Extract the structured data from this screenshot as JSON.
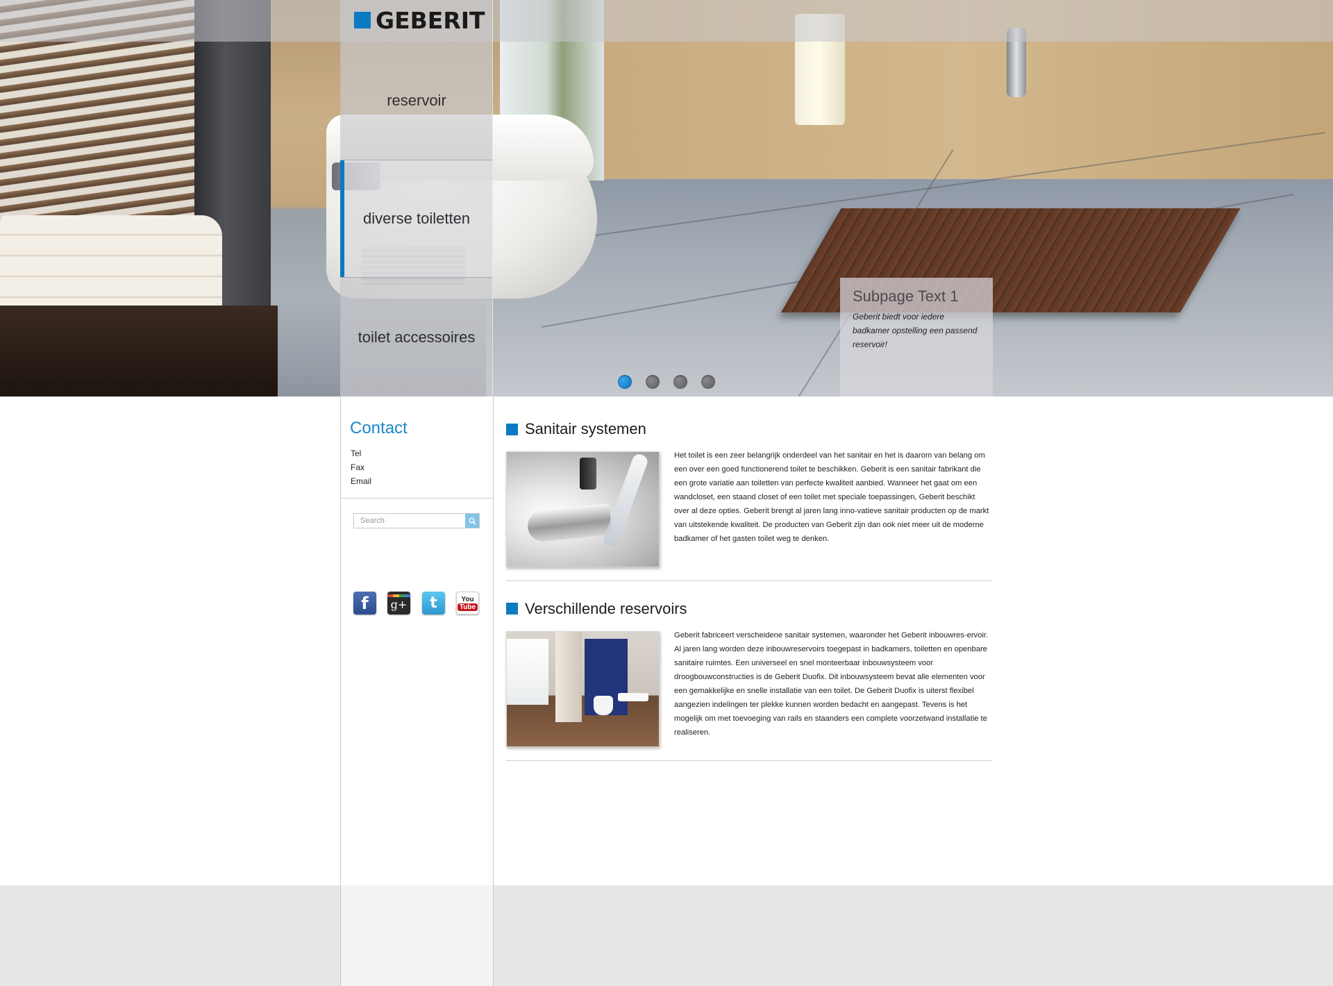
{
  "brand": {
    "name": "GEBERIT",
    "accent": "#0a7ac2"
  },
  "nav": {
    "items": [
      {
        "label": "reservoir",
        "active": false
      },
      {
        "label": "diverse toiletten",
        "active": true
      },
      {
        "label": "toilet accessoires",
        "active": false
      }
    ]
  },
  "slider": {
    "caption_title": "Subpage Text 1",
    "caption_text": "Geberit biedt voor iedere badkamer opstelling een passend reservoir!",
    "slide_count": 4,
    "active_slide": 1
  },
  "contact": {
    "title": "Contact",
    "lines": [
      "Tel",
      "Fax",
      "Email"
    ]
  },
  "search": {
    "placeholder": "Search",
    "icon": "search-icon"
  },
  "social": {
    "facebook": {
      "icon": "facebook-icon",
      "glyph": "f"
    },
    "googleplus": {
      "icon": "google-plus-icon",
      "glyph": "g+"
    },
    "twitter": {
      "icon": "twitter-icon",
      "glyph": "t"
    },
    "youtube": {
      "icon": "youtube-icon",
      "top": "You",
      "bottom": "Tube"
    }
  },
  "articles": [
    {
      "title": "Sanitair systemen",
      "body": "Het toilet is een zeer belangrijk onderdeel van het sanitair en het is daarom van belang om een over een goed functionerend toilet te beschikken. Geberit is een sanitair fabrikant die een grote variatie aan toiletten van perfecte kwaliteit aanbied. Wanneer het gaat om een wandcloset, een staand closet of een toilet met speciale toepassingen, Geberit beschikt over al deze opties. Geberit brengt al jaren lang inno-vatieve sanitair producten op de markt van uitstekende kwaliteit. De producten van Geberit zijn dan ook niet meer uit de moderne badkamer of het gasten toilet weg te denken."
    },
    {
      "title": "Verschillende reservoirs",
      "body": "Geberit fabriceert verscheidene sanitair systemen, waaronder het Geberit inbouwres-ervoir. Al jaren lang worden deze inbouwreservoirs toegepast in badkamers, toiletten en openbare sanitaire ruimtes. Een universeel en snel monteerbaar inbouwsysteem voor droogbouwconstructies is de Geberit Duofix. Dit inbouwsysteem bevat alle elementen voor een gemakkelijke en snelle installatie van een toilet. De Geberit Duofix is uiterst flexibel aangezien indelingen ter plekke kunnen worden bedacht en aangepast. Tevens is het mogelijk om met toevoeging van rails en staanders een complete voorzetwand installatie te realiseren."
    }
  ]
}
